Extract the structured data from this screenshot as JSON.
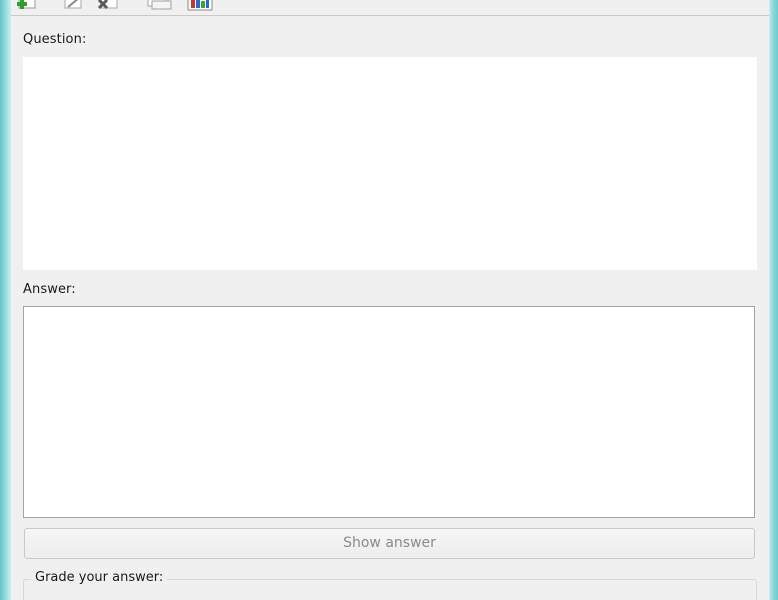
{
  "toolbar": {
    "buttons": [
      {
        "icon": "add-icon",
        "color": "#2e9e2e"
      },
      {
        "icon": "edit-icon",
        "color": "#9a9a9a"
      },
      {
        "icon": "delete-icon",
        "color": "#6a6a6a"
      },
      {
        "icon": "cards-icon",
        "color": "#9a9a9a"
      },
      {
        "icon": "chart-icon",
        "color": "#3366cc"
      }
    ]
  },
  "question": {
    "label": "Question:"
  },
  "answer": {
    "label": "Answer:",
    "value": "",
    "placeholder": ""
  },
  "show_answer": {
    "label": "Show answer"
  },
  "grade": {
    "label": "Grade your answer:"
  },
  "colors": {
    "window_frame": "#7fd3d6",
    "client_background": "#f0f0f0",
    "disabled_text": "#8a8a8a"
  }
}
